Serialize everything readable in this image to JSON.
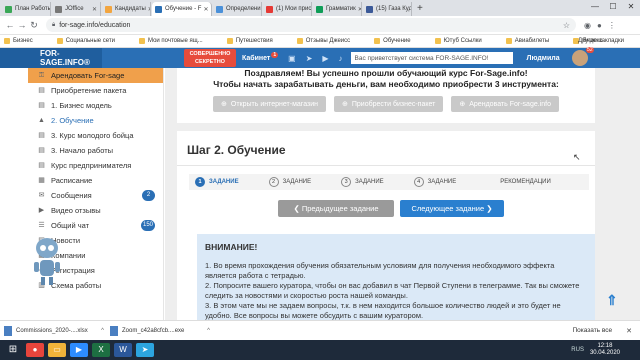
{
  "browser": {
    "tabs": [
      {
        "label": "План Работы",
        "color": "#3aa757"
      },
      {
        "label": "JOffice",
        "color": "#777"
      },
      {
        "label": "Кандидаты",
        "color": "#f2a540"
      },
      {
        "label": "Обучение - F",
        "color": "#2a6fb5",
        "active": true
      },
      {
        "label": "Определени",
        "color": "#4a90d9"
      },
      {
        "label": "(1) Мои прис",
        "color": "#e53935"
      },
      {
        "label": "Грамматик",
        "color": "#0f9d58"
      },
      {
        "label": "(15) Газа Куд",
        "color": "#3b5998"
      }
    ],
    "url": "for-sage.info/education",
    "bookmarks": [
      "Бизнес",
      "Социальные сети",
      "Мои почтовые ящ...",
      "Путешествия",
      "Отзывы Джеисс",
      "Обучение",
      "Ютуб Ссылки",
      "Авиабилеты",
      "Яндекс"
    ],
    "bookmarks_right": "Другие закладки"
  },
  "header": {
    "logo": "FOR-SAGE.INFO®",
    "secret": "СОВЕРШЕННО СЕКРЕТНО",
    "cabinet": "Кабинет",
    "cabinet_badge": "1",
    "welcome": "Вас приветствует система FOR-SAGE.INFO!",
    "user": "Людмила",
    "avatar_badge": "52"
  },
  "sidebar": [
    {
      "label": "Арендовать For-sage",
      "icon": "key-icon",
      "ic": "⚿"
    },
    {
      "label": "Приобретение пакета",
      "icon": "doc-icon",
      "ic": "▤"
    },
    {
      "label": "1. Бизнес модель",
      "icon": "doc-icon",
      "ic": "▤"
    },
    {
      "label": "2. Обучение",
      "icon": "graduation-icon",
      "ic": "▲"
    },
    {
      "label": "3. Курс молодого бойца",
      "icon": "doc-icon",
      "ic": "▤"
    },
    {
      "label": "3. Начало работы",
      "icon": "doc-icon",
      "ic": "▤"
    },
    {
      "label": "Курс предпринимателя",
      "icon": "doc-icon",
      "ic": "▤"
    },
    {
      "label": "Расписание",
      "icon": "calendar-icon",
      "ic": "▦"
    },
    {
      "label": "Сообщения",
      "icon": "envelope-icon",
      "ic": "✉",
      "count": "2"
    },
    {
      "label": "Видео отзывы",
      "icon": "video-icon",
      "ic": "▶"
    },
    {
      "label": "Общий чат",
      "icon": "chat-icon",
      "ic": "☰",
      "count": "150"
    },
    {
      "label": "Новости",
      "icon": "news-icon",
      "ic": "▤"
    },
    {
      "label": "Компании",
      "icon": "building-icon",
      "ic": "▦"
    },
    {
      "label": "Регистрация",
      "icon": "user-icon",
      "ic": "☺"
    },
    {
      "label": "Схема работы",
      "icon": "scheme-icon",
      "ic": "▥"
    }
  ],
  "congrats": {
    "line1": "Поздравляем! Вы успешно прошли обучающий курс For-Sage.info!",
    "line2": "Чтобы начать зарабатывать деньги, вам необходимо приобрести 3 инструмента:",
    "buttons": [
      "Открыть интернет-магазин",
      "Приобрести бизнес-пакет",
      "Арендовать For-sage.info"
    ]
  },
  "step": {
    "title": "Шаг 2. Обучение",
    "stages": [
      {
        "num": "1",
        "label": "ЗАДАНИЕ"
      },
      {
        "num": "2",
        "label": "ЗАДАНИЕ"
      },
      {
        "num": "3",
        "label": "ЗАДАНИЕ"
      },
      {
        "num": "4",
        "label": "ЗАДАНИЕ"
      },
      {
        "num": "",
        "label": "РЕКОМЕНДАЦИИ"
      }
    ],
    "prev": "Предыдущее задание",
    "next": "Следующее задание",
    "attention_title": "ВНИМАНИЕ!",
    "attention_lines": [
      "1. Во время прохождения обучения обязательным условиям для получения необходимого эффекта является работа с тетрадью.",
      "2. Попросите вашего куратора, чтобы он вас добавил в чат Первой Ступени в телеграмме. Так вы сможете следить за новостями и скоростью роста нашей команды.",
      "3. В этом чате мы не задаем вопросы, т.к. в нем находится большое количество людей и это будет не удобно. Все вопросы вы можете обсудить с вашим куратором."
    ]
  },
  "downloads": [
    {
      "name": "Commissions_2020-....xlsx"
    },
    {
      "name": "Zoom_c42a8cfcb....exe"
    }
  ],
  "downloads_showall": "Показать все",
  "clock": {
    "time": "12:18",
    "date": "30.04.2020"
  },
  "tray_lang": "RUS"
}
